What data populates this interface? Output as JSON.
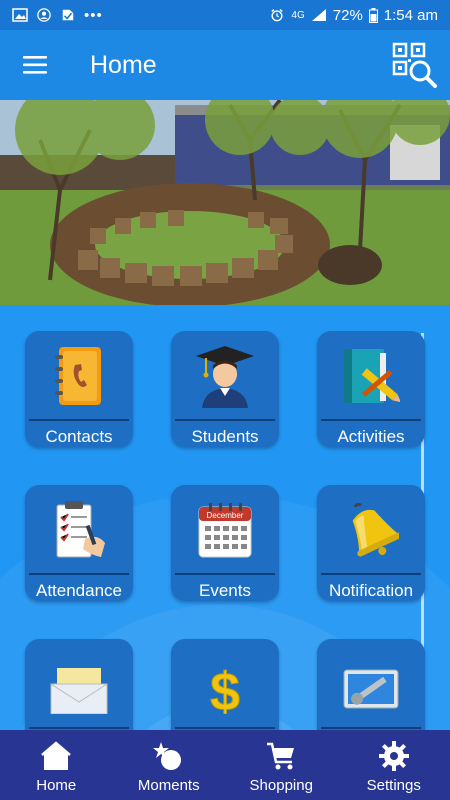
{
  "status_bar": {
    "network": "4G",
    "battery": "72%",
    "time": "1:54 am"
  },
  "app_bar": {
    "title": "Home"
  },
  "tiles": [
    {
      "label": "Contacts",
      "icon": "address-book-icon"
    },
    {
      "label": "Students",
      "icon": "graduate-icon"
    },
    {
      "label": "Activities",
      "icon": "book-pencil-icon"
    },
    {
      "label": "Attendance",
      "icon": "clipboard-icon"
    },
    {
      "label": "Events",
      "icon": "calendar-icon",
      "calendar_month": "December"
    },
    {
      "label": "Notification",
      "icon": "bell-icon"
    },
    {
      "label": "",
      "icon": "envelope-icon"
    },
    {
      "label": "",
      "icon": "dollar-icon"
    },
    {
      "label": "",
      "icon": "monitor-settings-icon"
    }
  ],
  "bottom_nav": {
    "items": [
      {
        "label": "Home",
        "icon": "home-icon"
      },
      {
        "label": "Moments",
        "icon": "moments-icon"
      },
      {
        "label": "Shopping",
        "icon": "cart-icon"
      },
      {
        "label": "Settings",
        "icon": "gear-icon"
      }
    ]
  },
  "colors": {
    "primary": "#1e88e5",
    "status_bar": "#1976d2",
    "tile": "#1e6fc4",
    "bottom_nav": "#283593"
  }
}
